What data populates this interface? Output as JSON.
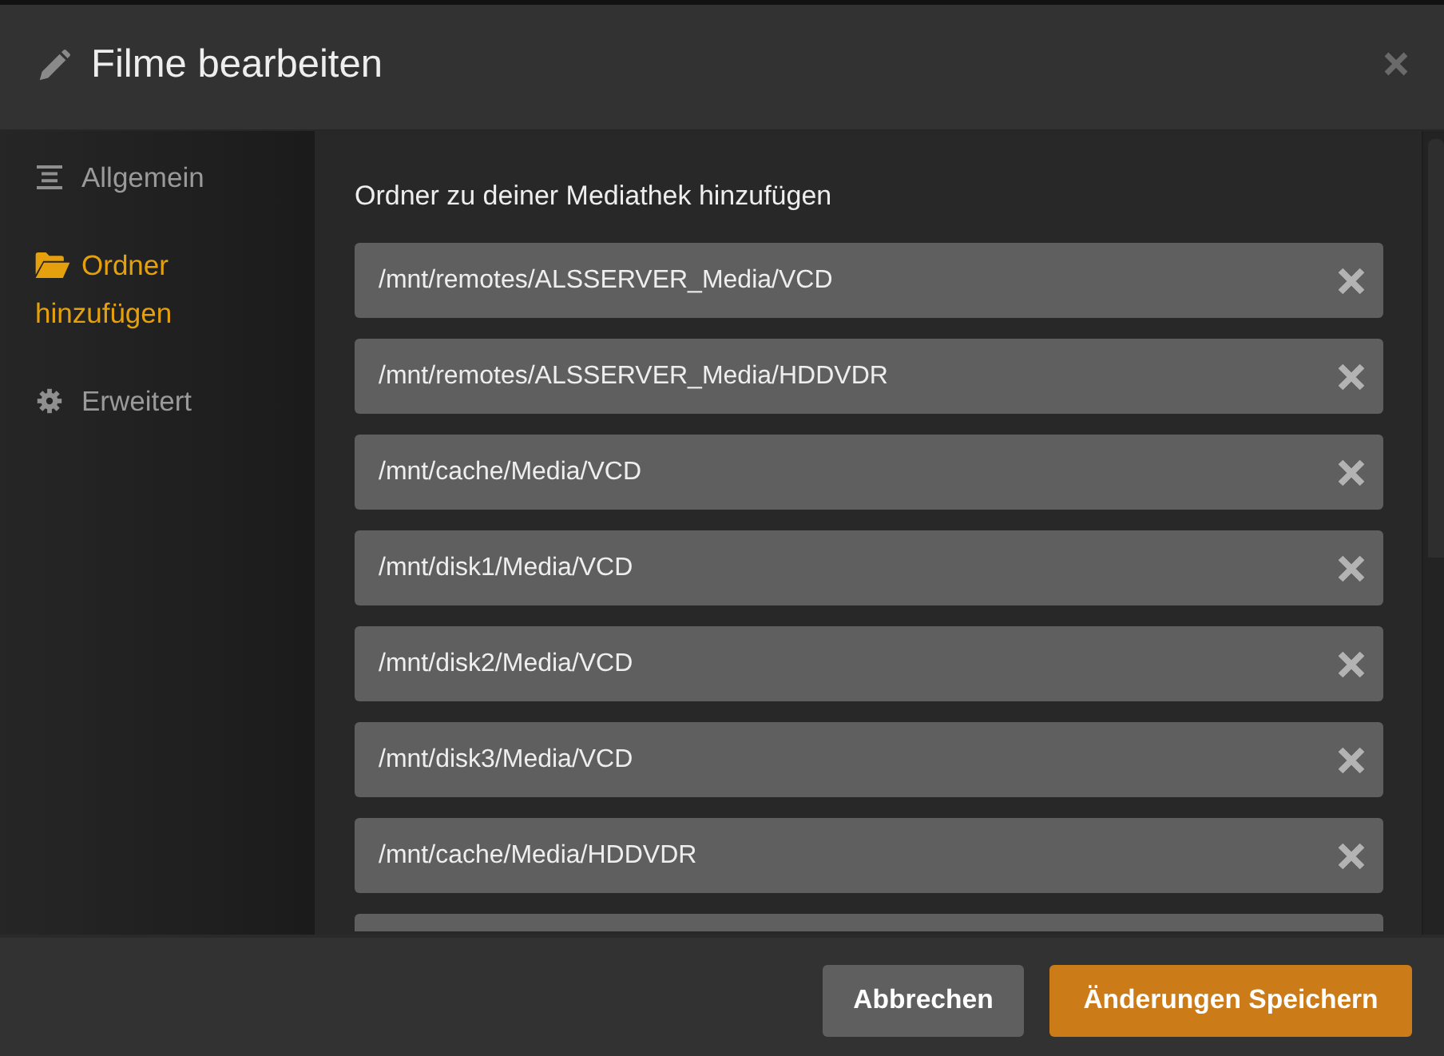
{
  "dialog": {
    "title": "Filme bearbeiten"
  },
  "sidebar": {
    "items": [
      {
        "kind": "general",
        "label": "Allgemein",
        "selected": false
      },
      {
        "kind": "folders",
        "label": "Ordner hinzufügen",
        "selected": true
      },
      {
        "kind": "advanced",
        "label": "Erweitert",
        "selected": false
      }
    ]
  },
  "content": {
    "heading": "Ordner zu deiner Mediathek hinzufügen",
    "folders": [
      {
        "kind": "path",
        "path": "/mnt/remotes/ALSSERVER_Media/VCD"
      },
      {
        "kind": "path",
        "path": "/mnt/remotes/ALSSERVER_Media/HDDVDR"
      },
      {
        "kind": "path",
        "path": "/mnt/cache/Media/VCD"
      },
      {
        "kind": "path",
        "path": "/mnt/disk1/Media/VCD"
      },
      {
        "kind": "path",
        "path": "/mnt/disk2/Media/VCD"
      },
      {
        "kind": "path",
        "path": "/mnt/disk3/Media/VCD"
      },
      {
        "kind": "path",
        "path": "/mnt/cache/Media/HDDVDR"
      },
      {
        "kind": "clipped"
      }
    ]
  },
  "footer": {
    "buttons": [
      {
        "kind": "secondary",
        "label": "Abbrechen"
      },
      {
        "kind": "primary",
        "label": "Änderungen Speichern"
      }
    ]
  }
}
